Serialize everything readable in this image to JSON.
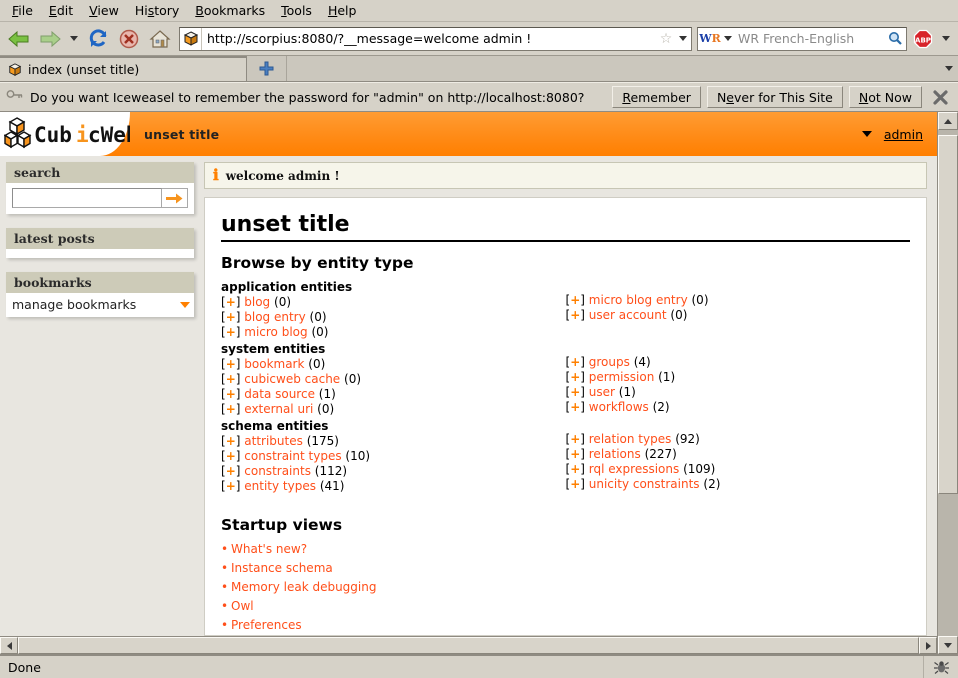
{
  "menubar": {
    "items": [
      {
        "label": "File",
        "accel": "F"
      },
      {
        "label": "Edit",
        "accel": "E"
      },
      {
        "label": "View",
        "accel": "V"
      },
      {
        "label": "History",
        "accel": "s"
      },
      {
        "label": "Bookmarks",
        "accel": "B"
      },
      {
        "label": "Tools",
        "accel": "T"
      },
      {
        "label": "Help",
        "accel": "H"
      }
    ]
  },
  "toolbar": {
    "back_icon": "back-arrow-icon",
    "forward_icon": "forward-arrow-icon",
    "history_dropdown_icon": "chevron-down-icon",
    "reload_icon": "reload-icon",
    "stop_icon": "stop-icon",
    "home_icon": "home-icon",
    "url": "http://scorpius:8080/?__message=welcome admin !",
    "site_icon": "cubicweb-favicon-icon",
    "bookmark_star_icon": "star-icon",
    "url_dropdown_icon": "chevron-down-icon",
    "search_engine": "WR",
    "search_placeholder": "WR French-English",
    "search_value": "",
    "search_icon": "magnifier-icon",
    "adblock_icon": "adblock-plus-icon"
  },
  "tabs": {
    "items": [
      {
        "title": "index (unset title)",
        "icon": "cubicweb-favicon-icon",
        "active": true
      }
    ],
    "new_tab_icon": "plus-icon",
    "tab_list_icon": "chevron-down-icon"
  },
  "notification": {
    "icon": "key-icon",
    "message": "Do you want Iceweasel to remember the password for \"admin\" on http://localhost:8080?",
    "buttons": [
      {
        "label": "Remember",
        "accel": "R"
      },
      {
        "label": "Never for This Site",
        "accel": "e"
      },
      {
        "label": "Not Now",
        "accel": "N"
      }
    ],
    "close_icon": "close-icon"
  },
  "page": {
    "brand": "CubicWeb",
    "brand_logo_icon": "cubicweb-cubes-logo-icon",
    "title": "unset title",
    "user_menu_caret_icon": "caret-down-icon",
    "user": "admin",
    "accent_color": "#ff8000",
    "link_color": "#ff4f1a"
  },
  "sidebar": {
    "search_box": {
      "title": "search",
      "input_value": "",
      "input_placeholder": "",
      "submit_icon": "arrow-right-icon"
    },
    "latest_posts_box": {
      "title": "latest posts",
      "items": []
    },
    "bookmarks_box": {
      "title": "bookmarks",
      "manage_label": "manage bookmarks",
      "manage_caret_icon": "caret-down-icon"
    }
  },
  "message": {
    "icon": "info-icon",
    "text": "welcome admin !"
  },
  "main": {
    "heading": "unset title",
    "browse_section_title": "Browse by entity type",
    "expand_marker": "[+]",
    "groups": [
      {
        "label": "application entities",
        "left": [
          {
            "name": "blog",
            "count": "(0)"
          },
          {
            "name": "blog entry",
            "count": "(0)"
          },
          {
            "name": "micro blog",
            "count": "(0)"
          }
        ],
        "right": [
          {
            "name": "micro blog entry",
            "count": "(0)"
          },
          {
            "name": "user account",
            "count": "(0)"
          }
        ]
      },
      {
        "label": "system entities",
        "left": [
          {
            "name": "bookmark",
            "count": "(0)"
          },
          {
            "name": "cubicweb cache",
            "count": "(0)"
          },
          {
            "name": "data source",
            "count": "(1)"
          },
          {
            "name": "external uri",
            "count": "(0)"
          }
        ],
        "right": [
          {
            "name": "groups",
            "count": "(4)"
          },
          {
            "name": "permission",
            "count": "(1)"
          },
          {
            "name": "user",
            "count": "(1)"
          },
          {
            "name": "workflows",
            "count": "(2)"
          }
        ]
      },
      {
        "label": "schema entities",
        "left": [
          {
            "name": "attributes",
            "count": "(175)"
          },
          {
            "name": "constraint types",
            "count": "(10)"
          },
          {
            "name": "constraints",
            "count": "(112)"
          },
          {
            "name": "entity types",
            "count": "(41)"
          }
        ],
        "right": [
          {
            "name": "relation types",
            "count": "(92)"
          },
          {
            "name": "relations",
            "count": "(227)"
          },
          {
            "name": "rql expressions",
            "count": "(109)"
          },
          {
            "name": "unicity constraints",
            "count": "(2)"
          }
        ]
      }
    ],
    "startup_section_title": "Startup views",
    "startup_views": [
      "What's new?",
      "Instance schema",
      "Memory leak debugging",
      "Owl",
      "Preferences"
    ]
  },
  "scrollbars": {
    "vertical": {
      "up_icon": "arrow-up-icon",
      "down_icon": "arrow-down-icon",
      "thumb_top_pct": 1,
      "thumb_height_pct": 71
    },
    "horizontal": {
      "left_icon": "arrow-left-icon",
      "right_icon": "arrow-right-icon",
      "thumb_left_pct": 0,
      "thumb_width_pct": 100
    }
  },
  "statusbar": {
    "text": "Done",
    "icon": "bug-icon"
  }
}
